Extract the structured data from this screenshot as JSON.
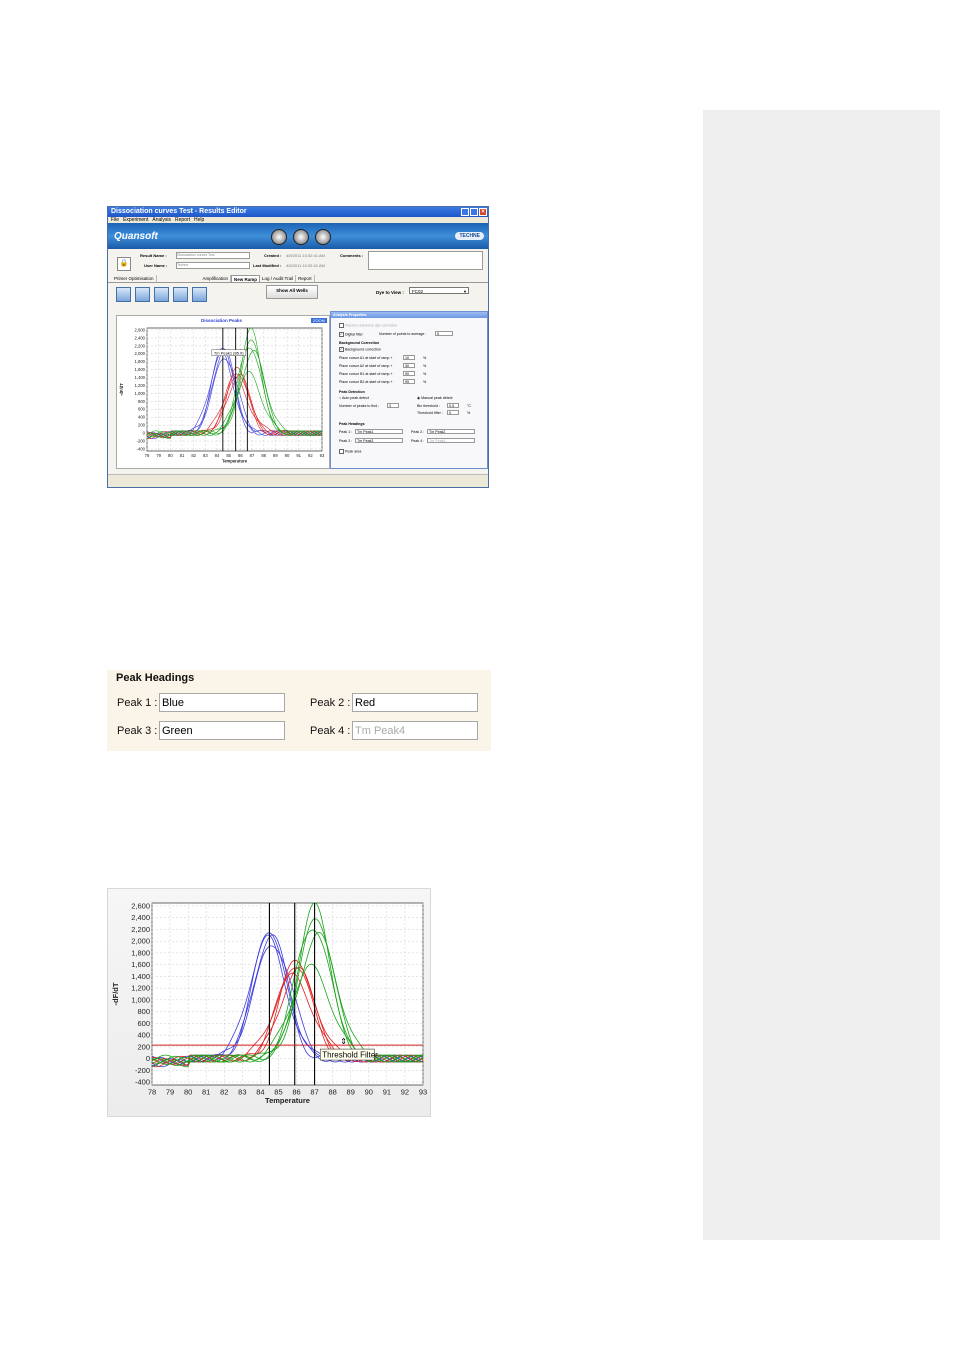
{
  "editor": {
    "window_title": "Dissociation curves Test - Results Editor",
    "menu": [
      "File",
      "Experiment",
      "Analysis",
      "Report",
      "Help"
    ],
    "brand": "Quansoft",
    "vendor": "TECHNE",
    "toolbar_icons": [
      "settings-icon",
      "save-icon",
      "export-icon"
    ],
    "result_name_label": "Result Name :",
    "result_name_value": "Dissociation curves Test",
    "user_name_label": "User Name :",
    "user_name_value": "Techne",
    "created_label": "Created :",
    "created_value": "4/5/2011 10:32:41 AM",
    "modified_label": "Last Modified :",
    "modified_value": "4/5/2011 10:32:41 AM",
    "comments_label": "Comments :",
    "tabs": [
      "Primer Optimisation",
      "Amplification",
      "New Ramp",
      "Log / Audit Trail",
      "Report"
    ],
    "active_tab": "New Ramp",
    "show_all_label": "Show All Wells",
    "dye_label": "Dye to View :",
    "dye_value": "FC02",
    "chart_title": "Dissociation Peaks",
    "chart_controls": "ZOOM",
    "tooltip": "Tm Peak1 (85.0)",
    "x_label": "Temperature",
    "y_label": "-dF/dT"
  },
  "properties": {
    "title": "Analysis Properties",
    "passive_ref": "Passive reference dye correction",
    "digital_filter": "Digital filter",
    "points_label": "Number of points to average :",
    "points_value": "5",
    "bg_heading": "Background Correction",
    "bg_correction": "Background correction",
    "cursors": [
      {
        "label": "Place cursor A1 at start of ramp +",
        "value": "10",
        "unit": "%"
      },
      {
        "label": "Place cursor A2 at start of ramp +",
        "value": "30",
        "unit": "%"
      },
      {
        "label": "Place cursor B1 at start of ramp +",
        "value": "90",
        "unit": "%"
      },
      {
        "label": "Place cursor B2 at start of ramp +",
        "value": "95",
        "unit": "%"
      }
    ],
    "peak_detection": "Peak Detection",
    "auto_peak": "Auto peak detect",
    "manual_peak": "Manual peak detect",
    "peaks_to_find_label": "Number of peaks to find :",
    "peaks_to_find_value": "3",
    "bin_threshold_label": "Bin threshold :",
    "bin_threshold_value": "0.5",
    "bin_threshold_unit": "°C",
    "threshold_filter_label": "Threshold filter :",
    "threshold_filter_value": "5",
    "threshold_filter_unit": "%",
    "peak_headings_heading": "Peak Headings",
    "peaks": [
      {
        "label": "Peak 1 :",
        "value": "Tm Peak1"
      },
      {
        "label": "Peak 2 :",
        "value": "Tm Peak2"
      },
      {
        "label": "Peak 3 :",
        "value": "Tm Peak3"
      },
      {
        "label": "Peak 4 :",
        "value": "Tm Peak4"
      }
    ],
    "peak_area": "Peak area"
  },
  "peak_headings": {
    "title": "Peak Headings",
    "peaks": [
      {
        "label": "Peak 1 :",
        "value": "Blue"
      },
      {
        "label": "Peak 2 :",
        "value": "Red"
      },
      {
        "label": "Peak 3 :",
        "value": "Green"
      },
      {
        "label": "Peak 4 :",
        "value": "Tm Peak4"
      }
    ]
  },
  "threshold_chart": {
    "tooltip": "Threshold Filter"
  },
  "chart_data": [
    {
      "type": "line",
      "title": "Dissociation Peaks",
      "xlabel": "Temperature",
      "ylabel": "-dF/dT",
      "x_ticks": [
        "78",
        "79",
        "80",
        "81",
        "82",
        "83",
        "84",
        "85",
        "86",
        "87",
        "88",
        "89",
        "90",
        "91",
        "92",
        "93"
      ],
      "y_ticks": [
        "2,600",
        "2,400",
        "2,200",
        "2,000",
        "1,800",
        "1,600",
        "1,400",
        "1,200",
        "1,000",
        "800",
        "600",
        "400",
        "200",
        "0",
        "-200",
        "-400"
      ],
      "xlim": [
        78,
        93
      ],
      "ylim": [
        -450,
        2650
      ],
      "grid": true,
      "vertical_markers": [
        84.5,
        85.6,
        86.6
      ],
      "series": [
        {
          "color": "#3b3bdb",
          "curves": [
            {
              "center": 84.5,
              "peak": 2200
            },
            {
              "center": 84.6,
              "peak": 2100
            },
            {
              "center": 84.4,
              "peak": 2000
            },
            {
              "center": 84.7,
              "peak": 1900
            }
          ]
        },
        {
          "color": "#e02020",
          "curves": [
            {
              "center": 85.8,
              "peak": 1650
            },
            {
              "center": 85.7,
              "peak": 1550
            },
            {
              "center": 85.9,
              "peak": 1450
            },
            {
              "center": 85.6,
              "peak": 1350
            }
          ]
        },
        {
          "color": "#1aa31a",
          "curves": [
            {
              "center": 86.9,
              "peak": 2600
            },
            {
              "center": 87.0,
              "peak": 2350
            },
            {
              "center": 86.8,
              "peak": 2200
            },
            {
              "center": 87.1,
              "peak": 2050
            },
            {
              "center": 86.7,
              "peak": 1500
            }
          ]
        }
      ]
    },
    {
      "type": "line",
      "xlabel": "Temperature",
      "ylabel": "-dF/dT",
      "x_ticks": [
        "78",
        "79",
        "80",
        "81",
        "82",
        "83",
        "84",
        "85",
        "86",
        "87",
        "88",
        "89",
        "90",
        "91",
        "92",
        "93"
      ],
      "y_ticks": [
        "2,600",
        "2,400",
        "2,200",
        "2,000",
        "1,800",
        "1,600",
        "1,400",
        "1,200",
        "1,000",
        "800",
        "600",
        "400",
        "200",
        "0",
        "-200",
        "-400"
      ],
      "xlim": [
        78,
        93
      ],
      "ylim": [
        -450,
        2650
      ],
      "grid": true,
      "threshold_line": 230,
      "vertical_markers": [
        84.5,
        85.9,
        87.0
      ],
      "series": [
        {
          "color": "#3b3bdb",
          "curves": [
            {
              "center": 84.5,
              "peak": 2200
            },
            {
              "center": 84.6,
              "peak": 2100
            },
            {
              "center": 84.4,
              "peak": 2050
            },
            {
              "center": 84.7,
              "peak": 1950
            }
          ]
        },
        {
          "color": "#e02020",
          "curves": [
            {
              "center": 86.0,
              "peak": 1700
            },
            {
              "center": 85.9,
              "peak": 1600
            },
            {
              "center": 86.1,
              "peak": 1500
            },
            {
              "center": 85.8,
              "peak": 1400
            }
          ]
        },
        {
          "color": "#1aa31a",
          "curves": [
            {
              "center": 87.0,
              "peak": 2600
            },
            {
              "center": 87.1,
              "peak": 2400
            },
            {
              "center": 86.9,
              "peak": 2250
            },
            {
              "center": 87.2,
              "peak": 2100
            },
            {
              "center": 86.8,
              "peak": 1550
            }
          ]
        }
      ]
    }
  ]
}
